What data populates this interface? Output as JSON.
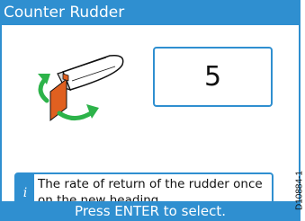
{
  "header": {
    "title": "Counter Rudder"
  },
  "setting": {
    "value": "5"
  },
  "info": {
    "icon": "i",
    "text": "The rate of return of the rudder once on the new heading."
  },
  "footer": {
    "prompt": "Press ENTER to select."
  },
  "reference": "D10884-1",
  "colors": {
    "accent": "#2f8fd0",
    "rudder": "#e06020",
    "arrow": "#2db34a"
  },
  "icons": [
    "boat-icon",
    "rudder-icon",
    "rotate-arrow-icon"
  ]
}
